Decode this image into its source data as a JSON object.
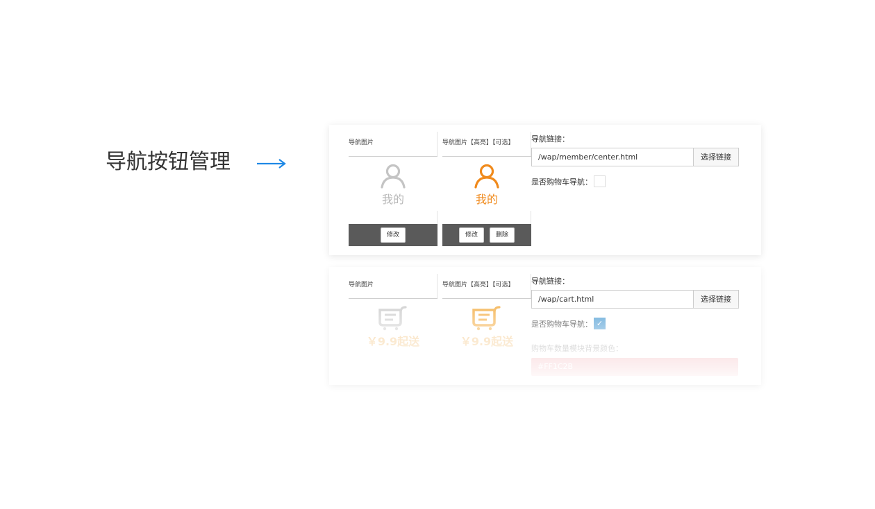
{
  "caption": "导航按钮管理",
  "colors": {
    "arrow": "#1e88e5",
    "orange": "#f08a1c",
    "gray_icon": "#c4c4c4",
    "cart_gray": "#d2d2d2",
    "cart_orange": "#f5b75b",
    "checked": "#5aa3d6"
  },
  "rows": [
    {
      "image_header": "导航图片",
      "highlight_header": "导航图片【高亮】【可选】",
      "icon": "user-icon",
      "label_normal": "我的",
      "label_highlight": "我的",
      "btn_edit": "修改",
      "btn_edit_b": "修改",
      "btn_delete": "删除",
      "link_label": "导航链接：",
      "link_value": "/wap/member/center.html",
      "link_btn": "选择链接",
      "cart_label": "是否购物车导航：",
      "cart_checked": false
    },
    {
      "image_header": "导航图片",
      "highlight_header": "导航图片【高亮】【可选】",
      "icon": "cart-icon",
      "label_normal": "￥9.9起送",
      "label_highlight": "￥9.9起送",
      "link_label": "导航链接：",
      "link_value": "/wap/cart.html",
      "link_btn": "选择链接",
      "cart_label": "是否购物车导航：",
      "cart_checked": true,
      "color_label": "购物车数量模块背景颜色：",
      "color_value": "#FF1C2B"
    }
  ]
}
